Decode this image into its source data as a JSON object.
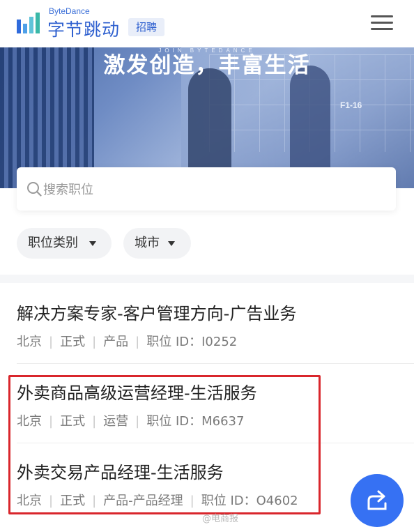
{
  "header": {
    "brand_en": "ByteDance",
    "brand_cn": "字节跳动",
    "badge": "招聘",
    "menu_icon": "hamburger-menu-icon"
  },
  "hero": {
    "title": "激发创造，丰富生活",
    "subtitle": "JOIN BYTEDANCE",
    "sign_text": "F1-16"
  },
  "search": {
    "placeholder": "搜索职位",
    "icon": "search-icon"
  },
  "filters": [
    {
      "label": "职位类别",
      "icon": "caret-down-icon"
    },
    {
      "label": "城市",
      "icon": "caret-down-icon"
    }
  ],
  "jobs": [
    {
      "title": "解决方案专家-客户管理方向-广告业务",
      "city": "北京",
      "type": "正式",
      "category": "产品",
      "id_label": "职位 ID：",
      "id": "I0252"
    },
    {
      "title": "外卖商品高级运营经理-生活服务",
      "city": "北京",
      "type": "正式",
      "category": "运营",
      "id_label": "职位 ID：",
      "id": "M6637"
    },
    {
      "title": "外卖交易产品经理-生活服务",
      "city": "北京",
      "type": "正式",
      "category": "产品-产品经理",
      "id_label": "职位 ID：",
      "id": "O4602"
    }
  ],
  "fab": {
    "icon": "share-icon"
  },
  "watermark": "@电商报",
  "colors": {
    "brand_blue": "#2d5fcf",
    "fab_blue": "#3671f3",
    "highlight_red": "#d9262c"
  }
}
